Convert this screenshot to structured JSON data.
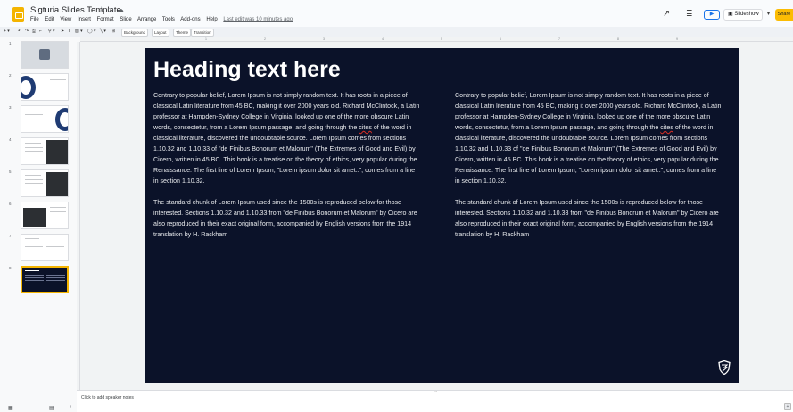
{
  "app": {
    "doc_title": "Sigturia Slides Template",
    "menus": [
      "File",
      "Edit",
      "View",
      "Insert",
      "Format",
      "Slide",
      "Arrange",
      "Tools",
      "Add-ons",
      "Help"
    ],
    "last_edit": "Last edit was 10 minutes ago"
  },
  "header_right": {
    "slideshow_label": "Slideshow",
    "share_label": "Share"
  },
  "toolbar": {
    "background_label": "Background",
    "layout_label": "Layout",
    "theme_label": "Theme",
    "transition_label": "Transition"
  },
  "ruler_ticks": [
    "1",
    "2",
    "3",
    "4",
    "5",
    "6",
    "7",
    "8",
    "9"
  ],
  "filmstrip": {
    "slide_numbers": [
      "1",
      "2",
      "3",
      "4",
      "5",
      "6",
      "7",
      "8"
    ],
    "active_slide": 8
  },
  "slide": {
    "heading": "Heading text here",
    "left_column": {
      "para1_before": "Contrary to popular belief, Lorem Ipsum is not simply random text. It has roots in a piece of classical Latin literature from 45 BC, making it over 2000 years old. Richard McClintock, a Latin professor at Hampden-Sydney College in Virginia, looked up one of the more obscure Latin words, consectetur, from a Lorem Ipsum passage, and going through the ",
      "para1_misspelled": "cites",
      "para1_after": " of the word in classical literature, discovered the undoubtable source. Lorem Ipsum comes from sections 1.10.32 and 1.10.33 of \"de Finibus Bonorum et Malorum\" (The Extremes of Good and Evil) by Cicero, written in 45 BC. This book is a treatise on the theory of ethics, very popular during the Renaissance. The first line of Lorem Ipsum, \"Lorem ipsum dolor sit amet..\", comes from a line in section 1.10.32.",
      "para2": "The standard chunk of Lorem Ipsum used since the 1500s is reproduced below for those interested. Sections 1.10.32 and 1.10.33 from \"de Finibus Bonorum et Malorum\" by Cicero are also reproduced in their exact original form, accompanied by English versions from the 1914 translation by H. Rackham"
    },
    "right_column": {
      "para1_before": "Contrary to popular belief, Lorem Ipsum is not simply random text. It has roots in a piece of classical Latin literature from 45 BC, making it over 2000 years old. Richard McClintock, a Latin professor at Hampden-Sydney College in Virginia, looked up one of the more obscure Latin words, consectetur, from a Lorem Ipsum passage, and going through the ",
      "para1_misspelled": "cites",
      "para1_after": " of the word in classical literature, discovered the undoubtable source. Lorem Ipsum comes from sections 1.10.32 and 1.10.33 of \"de Finibus Bonorum et Malorum\" (The Extremes of Good and Evil) by Cicero, written in 45 BC. This book is a treatise on the theory of ethics, very popular during the Renaissance. The first line of Lorem Ipsum, \"Lorem ipsum dolor sit amet..\", comes from a line in section 1.10.32.",
      "para2": "The standard chunk of Lorem Ipsum used since the 1500s is reproduced below for those interested. Sections 1.10.32 and 1.10.33 from \"de Finibus Bonorum et Malorum\" by Cicero are also reproduced in their exact original form, accompanied by English versions from the 1914 translation by H. Rackham"
    }
  },
  "speaker_notes": {
    "placeholder": "Click to add speaker notes"
  },
  "colors": {
    "slide_bg": "#0b1229",
    "accent": "#f4b400",
    "share": "#fbbc04"
  },
  "icons": [
    "slides-logo-icon",
    "star-icon",
    "folder-icon",
    "cloud-icon",
    "trend-icon",
    "comment-icon",
    "camera-icon",
    "shield-logo-icon",
    "grid-view-icon",
    "list-view-icon",
    "collapse-icon",
    "explore-icon"
  ]
}
